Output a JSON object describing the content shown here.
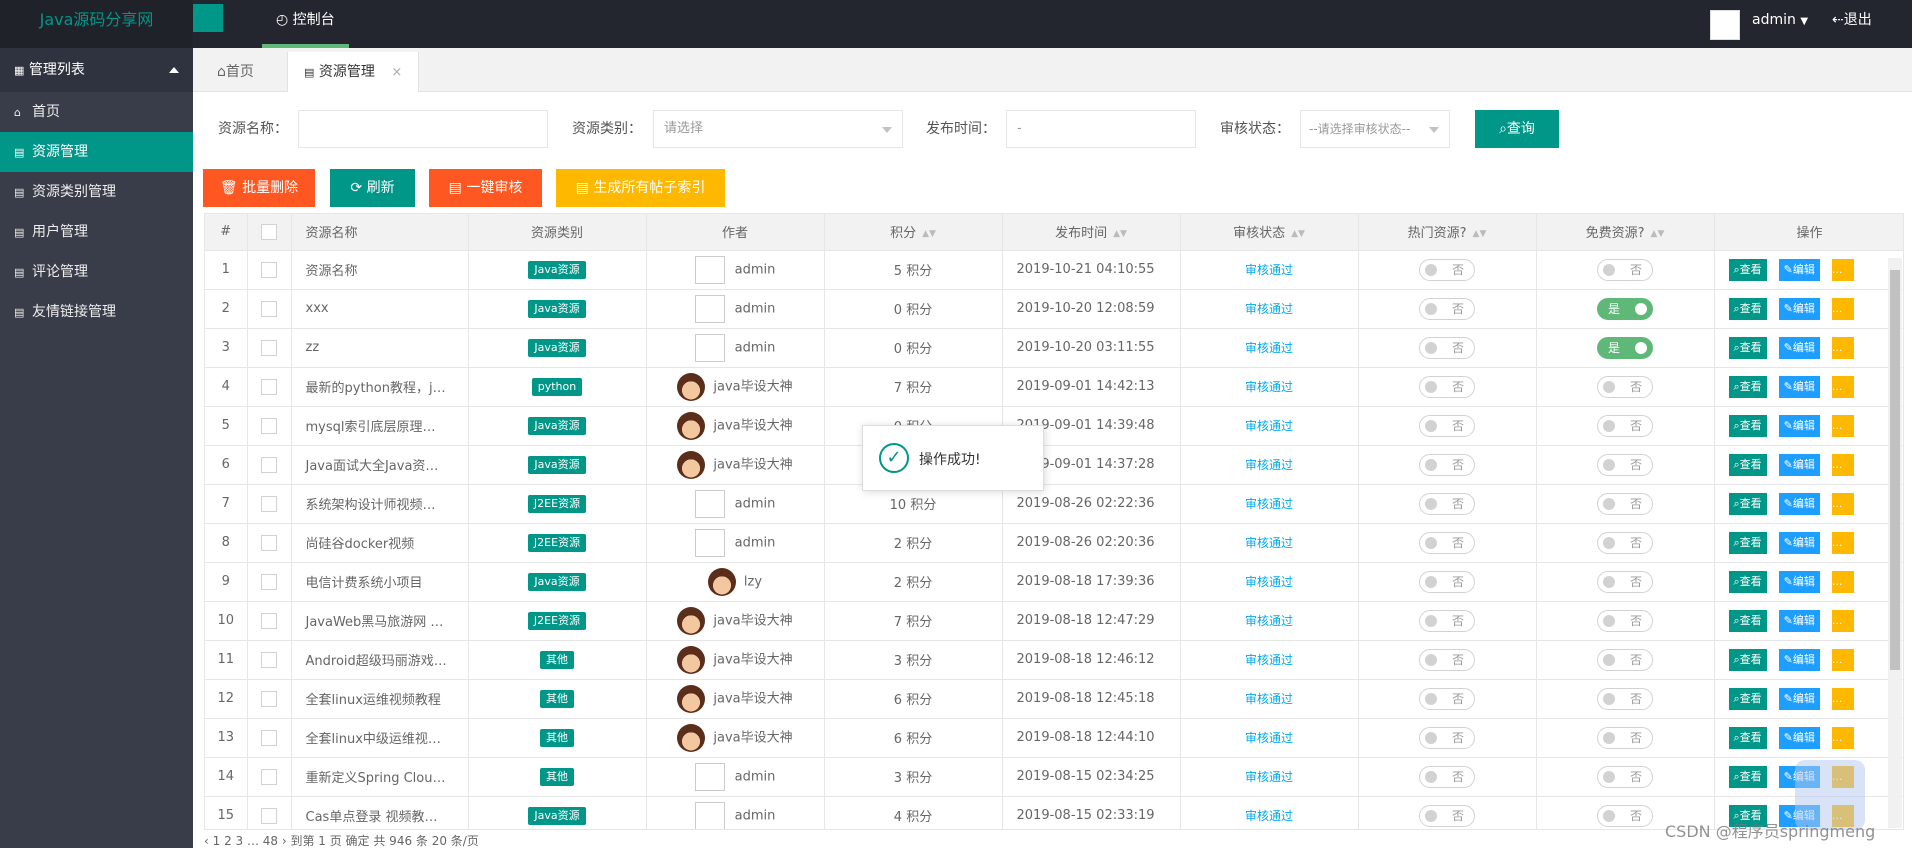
{
  "header": {
    "logo": "Java源码分享网",
    "nav_console": "控制台",
    "user": "admin",
    "logout": "退出"
  },
  "sidebar": {
    "title": "管理列表",
    "items": [
      {
        "label": "首页"
      },
      {
        "label": "资源管理"
      },
      {
        "label": "资源类别管理"
      },
      {
        "label": "用户管理"
      },
      {
        "label": "评论管理"
      },
      {
        "label": "友情链接管理"
      }
    ]
  },
  "tabs": {
    "home": "首页",
    "resource": "资源管理",
    "close": "×"
  },
  "search": {
    "name_label": "资源名称：",
    "name_value": "",
    "type_label": "资源类别：",
    "type_placeholder": "请选择",
    "time_label": "发布时间：",
    "time_value": "-",
    "status_label": "审核状态：",
    "status_placeholder": "--请选择审核状态--",
    "query": "查询"
  },
  "actions": {
    "batch_delete": "批量删除",
    "refresh": "刷新",
    "one_click_audit": "一键审核",
    "gen_index": "生成所有帖子索引"
  },
  "table": {
    "headers": {
      "num": "#",
      "name": "资源名称",
      "type": "资源类别",
      "author": "作者",
      "points": "积分",
      "time": "发布时间",
      "status": "审核状态",
      "hot": "热门资源?",
      "free": "免费资源?",
      "ops": "操作"
    },
    "op_labels": {
      "view": "查看",
      "edit": "编辑",
      "more": "..."
    },
    "switch_labels": {
      "off": "否",
      "on": "是"
    },
    "rows": [
      {
        "num": "1",
        "name": "资源名称",
        "type": "Java资源",
        "author": "admin",
        "points": "5 积分",
        "time": "2019-10-21 04:10:55",
        "status": "审核通过",
        "hot": false,
        "free": false
      },
      {
        "num": "2",
        "name": "xxx",
        "type": "Java资源",
        "author": "admin",
        "points": "0 积分",
        "time": "2019-10-20 12:08:59",
        "status": "审核通过",
        "hot": false,
        "free": true
      },
      {
        "num": "3",
        "name": "zz",
        "type": "Java资源",
        "author": "admin",
        "points": "0 积分",
        "time": "2019-10-20 03:11:55",
        "status": "审核通过",
        "hot": false,
        "free": true
      },
      {
        "num": "4",
        "name": "最新的python教程，j…",
        "type": "python",
        "author": "java毕设大神",
        "points": "7 积分",
        "time": "2019-09-01 14:42:13",
        "status": "审核通过",
        "hot": false,
        "free": false
      },
      {
        "num": "5",
        "name": "mysql索引底层原理…",
        "type": "Java资源",
        "author": "java毕设大神",
        "points": "0 积分",
        "time": "2019-09-01 14:39:48",
        "status": "审核通过",
        "hot": false,
        "free": false
      },
      {
        "num": "6",
        "name": "Java面试大全Java资…",
        "type": "Java资源",
        "author": "java毕设大神",
        "points": "",
        "time": "2019-09-01 14:37:28",
        "status": "审核通过",
        "hot": false,
        "free": false
      },
      {
        "num": "7",
        "name": "系统架构设计师视频…",
        "type": "J2EE资源",
        "author": "admin",
        "points": "10 积分",
        "time": "2019-08-26 02:22:36",
        "status": "审核通过",
        "hot": false,
        "free": false
      },
      {
        "num": "8",
        "name": "尚硅谷docker视频",
        "type": "J2EE资源",
        "author": "admin",
        "points": "2 积分",
        "time": "2019-08-26 02:20:36",
        "status": "审核通过",
        "hot": false,
        "free": false
      },
      {
        "num": "9",
        "name": "电信计费系统小项目",
        "type": "Java资源",
        "author": "lzy",
        "points": "2 积分",
        "time": "2019-08-18 17:39:36",
        "status": "审核通过",
        "hot": false,
        "free": false
      },
      {
        "num": "10",
        "name": "JavaWeb黑马旅游网 …",
        "type": "J2EE资源",
        "author": "java毕设大神",
        "points": "7 积分",
        "time": "2019-08-18 12:47:29",
        "status": "审核通过",
        "hot": false,
        "free": false
      },
      {
        "num": "11",
        "name": "Android超级玛丽游戏…",
        "type": "其他",
        "author": "java毕设大神",
        "points": "3 积分",
        "time": "2019-08-18 12:46:12",
        "status": "审核通过",
        "hot": false,
        "free": false
      },
      {
        "num": "12",
        "name": "全套linux运维视频教程",
        "type": "其他",
        "author": "java毕设大神",
        "points": "6 积分",
        "time": "2019-08-18 12:45:18",
        "status": "审核通过",
        "hot": false,
        "free": false
      },
      {
        "num": "13",
        "name": "全套linux中级运维视…",
        "type": "其他",
        "author": "java毕设大神",
        "points": "6 积分",
        "time": "2019-08-18 12:44:10",
        "status": "审核通过",
        "hot": false,
        "free": false
      },
      {
        "num": "14",
        "name": "重新定义Spring Clou…",
        "type": "其他",
        "author": "admin",
        "points": "3 积分",
        "time": "2019-08-15 02:34:25",
        "status": "审核通过",
        "hot": false,
        "free": false
      },
      {
        "num": "15",
        "name": "Cas单点登录 视频教…",
        "type": "Java资源",
        "author": "admin",
        "points": "4 积分",
        "time": "2019-08-15 02:33:19",
        "status": "审核通过",
        "hot": false,
        "free": false
      }
    ]
  },
  "pager": {
    "text": "‹ 1 2 3 … 48 › 到第 1 页 确定 共 946 条 20 条/页"
  },
  "toast": {
    "message": "操作成功!"
  },
  "watermark": "CSDN @程序员springmeng"
}
